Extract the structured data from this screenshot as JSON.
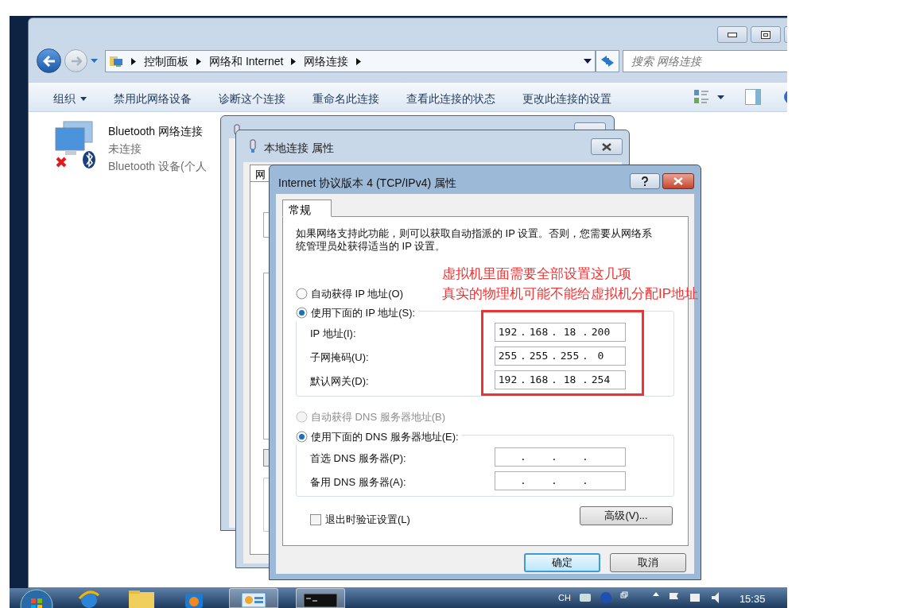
{
  "explorer": {
    "breadcrumb": [
      "控制面板",
      "网络和 Internet",
      "网络连接"
    ],
    "search": {
      "placeholder": "搜索 网络连接"
    },
    "toolbar": [
      {
        "label": "组织",
        "dropdown": true
      },
      {
        "label": "禁用此网络设备",
        "dropdown": false
      },
      {
        "label": "诊断这个连接",
        "dropdown": false
      },
      {
        "label": "重命名此连接",
        "dropdown": false
      },
      {
        "label": "查看此连接的状态",
        "dropdown": false
      },
      {
        "label": "更改此连接的设置",
        "dropdown": false
      }
    ],
    "items": [
      {
        "name": "Bluetooth 网络连接",
        "status": "未连接",
        "device": "Bluetooth 设备(个人"
      }
    ]
  },
  "properties_window": {
    "title": "本地连接 属性",
    "tab": "网"
  },
  "ipv4_dialog": {
    "title": "Internet 协议版本 4 (TCP/IPv4) 属性",
    "tabs": [
      {
        "label": "常规",
        "selected": true
      }
    ],
    "description": "如果网络支持此功能，则可以获取自动指派的 IP 设置。否则，您需要从网络系统管理员处获得适当的 IP 设置。",
    "separator": ".",
    "ip_options": [
      {
        "label": "自动获得 IP 地址(O)",
        "selected": false,
        "disabled": false
      },
      {
        "label": "使用下面的 IP 地址(S):",
        "selected": true,
        "disabled": false
      }
    ],
    "ip_fields": [
      {
        "label": "IP 地址(I):",
        "octets": [
          "192",
          "168",
          "18",
          "200"
        ]
      },
      {
        "label": "子网掩码(U):",
        "octets": [
          "255",
          "255",
          "255",
          "0"
        ]
      },
      {
        "label": "默认网关(D):",
        "octets": [
          "192",
          "168",
          "18",
          "254"
        ]
      }
    ],
    "dns_options": [
      {
        "label": "自动获得 DNS 服务器地址(B)",
        "selected": false,
        "disabled": true
      },
      {
        "label": "使用下面的 DNS 服务器地址(E):",
        "selected": true,
        "disabled": false
      }
    ],
    "dns_fields": [
      {
        "label": "首选 DNS 服务器(P):"
      },
      {
        "label": "备用 DNS 服务器(A):"
      }
    ],
    "validate": {
      "label": "退出时验证设置(L)",
      "checked": false
    },
    "advanced_button": "高级(V)...",
    "buttons": [
      {
        "label": "确定",
        "default": true
      },
      {
        "label": "取消",
        "default": false
      }
    ]
  },
  "annotation": {
    "lines": [
      "虚拟机里面需要全部设置这几项",
      "真实的物理机可能不能给虚拟机分配IP地址"
    ]
  },
  "taskbar": {
    "apps": [
      {
        "kind": "browser",
        "active": false
      },
      {
        "kind": "folder",
        "active": false
      },
      {
        "kind": "media",
        "active": false
      },
      {
        "kind": "panel",
        "active": true
      },
      {
        "kind": "console",
        "active": true
      }
    ],
    "language": "CH",
    "time": "15:35"
  }
}
